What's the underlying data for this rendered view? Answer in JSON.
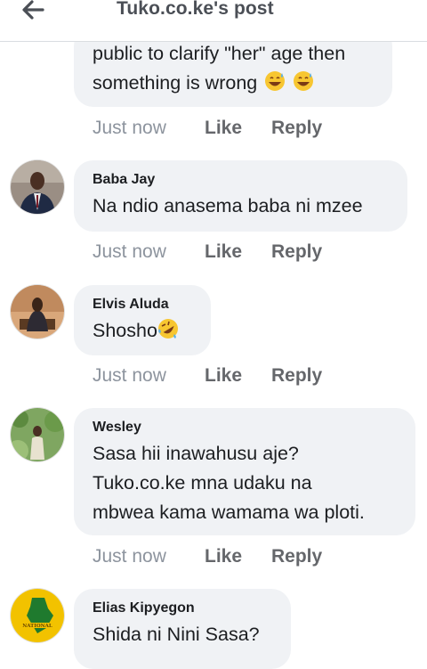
{
  "header": {
    "title": "Tuko.co.ke's post",
    "back_icon": "back-arrow-icon"
  },
  "actions": {
    "time": "Just now",
    "like": "Like",
    "reply": "Reply"
  },
  "comments": [
    {
      "name": "",
      "lines": [
        "public to clarify \"her\" age then",
        "something is wrong"
      ],
      "emoji": [
        "grinning-sweat-emoji",
        "grinning-sweat-emoji"
      ]
    },
    {
      "name": "Baba Jay",
      "lines": [
        "Na ndio anasema baba ni mzee"
      ]
    },
    {
      "name": "Elvis Aluda",
      "lines": [
        "Shosho"
      ],
      "emoji": [
        "rolling-laughing-emoji"
      ]
    },
    {
      "name": "Wesley",
      "lines": [
        "Sasa hii inawahusu aje?",
        "Tuko.co.ke mna udaku na",
        "mbwea kama wamama wa ploti."
      ]
    },
    {
      "name": "Elias Kipyegon",
      "lines": [
        "Shida ni Nini Sasa?"
      ],
      "avatar_text": "NATIONAL"
    }
  ],
  "colors": {
    "bubble": "#f0f2f5",
    "meta_time": "#8d949e",
    "meta_action": "#65676b",
    "title": "#4b4f56"
  }
}
